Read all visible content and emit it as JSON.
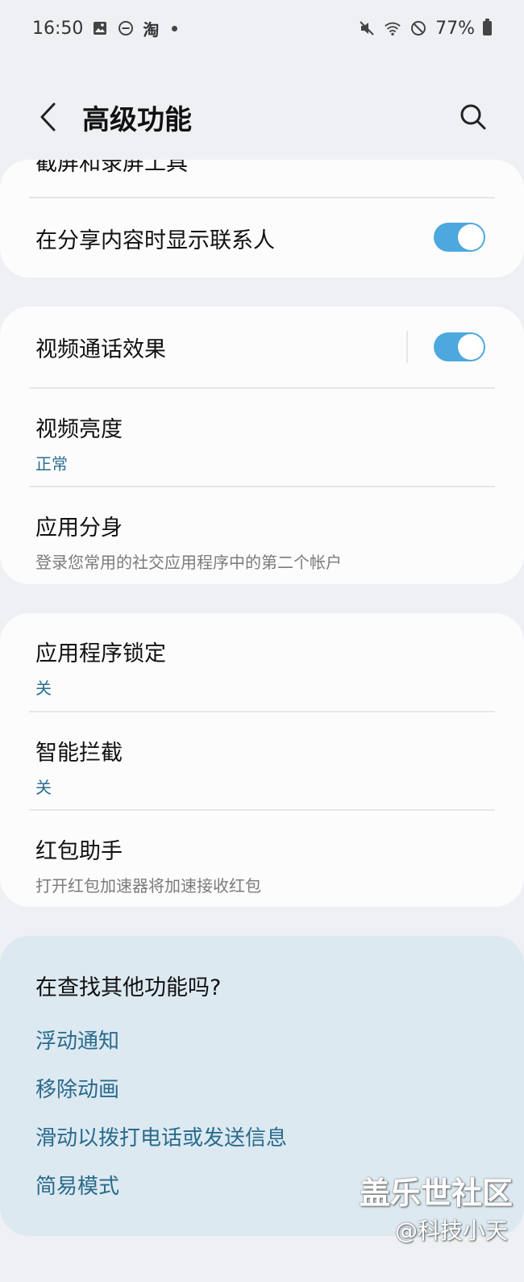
{
  "status_bar": {
    "time": "16:50",
    "notif_app": "淘",
    "battery": "77%"
  },
  "header": {
    "title": "高级功能"
  },
  "card1": {
    "partial_item": "截屏和录屏工具",
    "item_share_contacts": "在分享内容时显示联系人",
    "share_contacts_on": true
  },
  "card2": {
    "items": [
      {
        "title": "视频通话效果",
        "toggle_on": true
      },
      {
        "title": "视频亮度",
        "sub": "正常"
      },
      {
        "title": "应用分身",
        "sub": "登录您常用的社交应用程序中的第二个帐户"
      }
    ]
  },
  "card3": {
    "items": [
      {
        "title": "应用程序锁定",
        "sub": "关"
      },
      {
        "title": "智能拦截",
        "sub": "关"
      },
      {
        "title": "红包助手",
        "sub": "打开红包加速器将加速接收红包"
      }
    ]
  },
  "suggestions": {
    "title": "在查找其他功能吗?",
    "links": [
      "浮动通知",
      "移除动画",
      "滑动以拨打电话或发送信息",
      "简易模式"
    ]
  },
  "watermark": {
    "line1": "盖乐世社区",
    "line2": "@科技小天"
  },
  "colors": {
    "accent": "#4da8dd",
    "link": "#2a6a8c",
    "background": "#eef0f3"
  }
}
